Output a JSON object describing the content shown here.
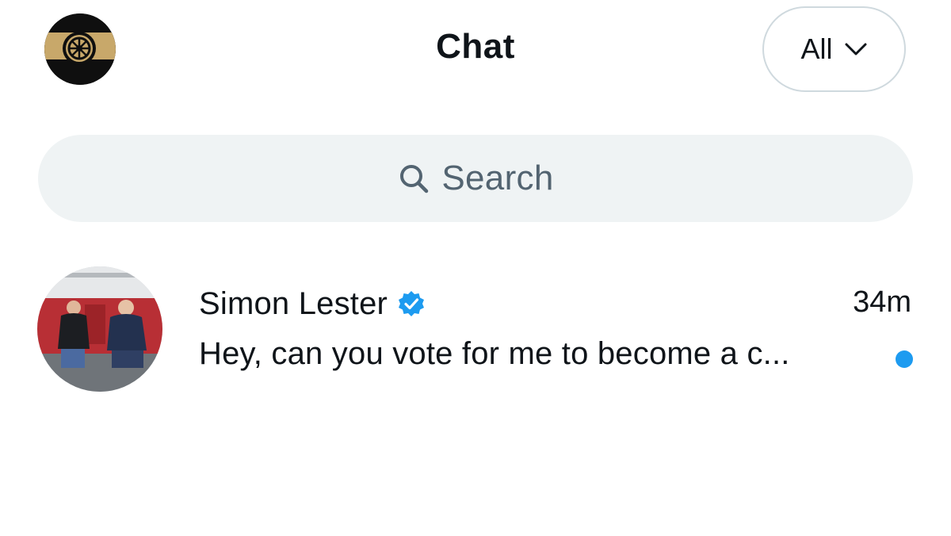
{
  "header": {
    "title": "Chat",
    "profile_icon": "cannon-logo-icon",
    "filter": {
      "label": "All",
      "icon": "chevron-down-icon"
    }
  },
  "search": {
    "placeholder": "Search",
    "icon": "search-icon"
  },
  "conversations": [
    {
      "name": "Simon Lester",
      "verified": true,
      "verified_icon": "verified-badge-icon",
      "time": "34m",
      "preview": "Hey, can you vote for me to become a c...",
      "unread": true
    }
  ],
  "colors": {
    "accent": "#1d9bf0",
    "text": "#0f1419",
    "muted": "#536471",
    "search_bg": "#eff3f4",
    "logo_gold": "#c8a86a"
  }
}
